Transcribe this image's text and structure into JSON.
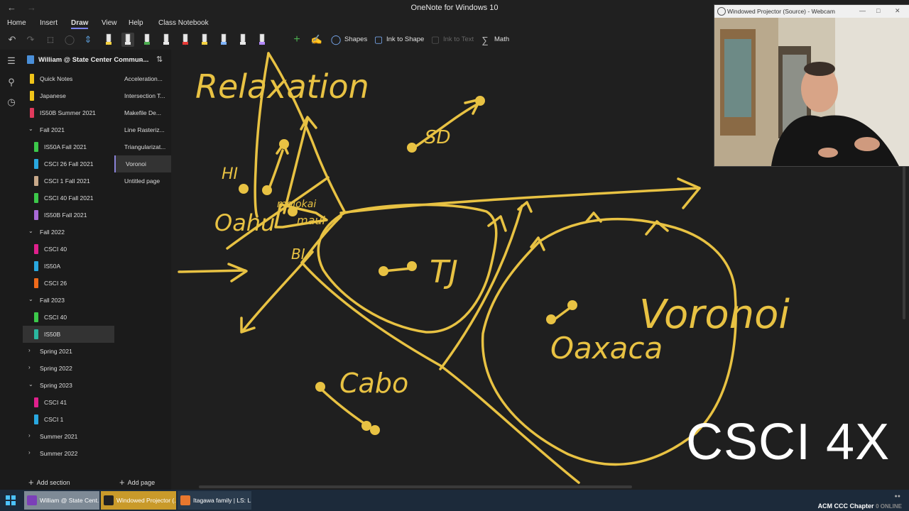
{
  "window": {
    "title": "OneNote for Windows 10"
  },
  "menu": {
    "home": "Home",
    "insert": "Insert",
    "draw": "Draw",
    "view": "View",
    "help": "Help",
    "class_notebook": "Class Notebook"
  },
  "toolbar": {
    "shapes": "Shapes",
    "ink_to_shape": "Ink to Shape",
    "ink_to_text": "Ink to Text",
    "math": "Math"
  },
  "pen_colors": [
    "#f4d03f",
    "#e8e8e8",
    "#4caf50",
    "#e8e8e8",
    "#e53935",
    "#f4d03f",
    "#7fb3ff",
    "#e8e8e8",
    "#b388ff"
  ],
  "notebook": {
    "title": "William @ State Center Commun..."
  },
  "sections": [
    {
      "label": "Quick Notes",
      "color": "#f0c419",
      "level": 0
    },
    {
      "label": "Japanese",
      "color": "#f0c419",
      "level": 0
    },
    {
      "label": "IS50B Summer 2021",
      "color": "#e03a5c",
      "level": 0
    },
    {
      "label": "Fall 2021",
      "group": true,
      "expanded": true
    },
    {
      "label": "IS50A Fall 2021",
      "color": "#3cc84a",
      "level": 1
    },
    {
      "label": "CSCI 26 Fall 2021",
      "color": "#29a8e0",
      "level": 1
    },
    {
      "label": "CSCI 1 Fall 2021",
      "color": "#c8a98a",
      "level": 1
    },
    {
      "label": "CSCI 40 Fall 2021",
      "color": "#3cc84a",
      "level": 1
    },
    {
      "label": "IS50B Fall 2021",
      "color": "#a96ad6",
      "level": 1
    },
    {
      "label": "Fall 2022",
      "group": true,
      "expanded": true
    },
    {
      "label": "CSCI 40",
      "color": "#e0208c",
      "level": 1
    },
    {
      "label": "IS50A",
      "color": "#29a8e0",
      "level": 1
    },
    {
      "label": "CSCI 26",
      "color": "#f06a1a",
      "level": 1
    },
    {
      "label": "Fall 2023",
      "group": true,
      "expanded": true
    },
    {
      "label": "CSCI 40",
      "color": "#3cc84a",
      "level": 1
    },
    {
      "label": "IS50B",
      "color": "#2ab8a0",
      "level": 1,
      "selected": true
    },
    {
      "label": "Spring 2021",
      "group": true,
      "expanded": false
    },
    {
      "label": "Spring 2022",
      "group": true,
      "expanded": false
    },
    {
      "label": "Spring 2023",
      "group": true,
      "expanded": true
    },
    {
      "label": "CSCI 41",
      "color": "#e0208c",
      "level": 1
    },
    {
      "label": "CSCI 1",
      "color": "#29a8e0",
      "level": 1
    },
    {
      "label": "Summer 2021",
      "group": true,
      "expanded": false
    },
    {
      "label": "Summer 2022",
      "group": true,
      "expanded": false
    }
  ],
  "pages": [
    {
      "label": "Acceleration..."
    },
    {
      "label": "Intersection T..."
    },
    {
      "label": "Makefile De..."
    },
    {
      "label": "Line Rasteriz..."
    },
    {
      "label": "Triangularizat..."
    },
    {
      "label": "Voronoi",
      "selected": true
    },
    {
      "label": "Untitled page"
    }
  ],
  "add_section": "Add section",
  "add_page": "Add page",
  "ink": {
    "color": "#e8c243",
    "words": {
      "relaxation": "Relaxation",
      "hi": "HI",
      "oahu": "Oahu",
      "molokai": "molokai",
      "maui": "maui",
      "bi": "BI",
      "sd": "SD",
      "tj": "TJ",
      "oaxaca": "Oaxaca",
      "voronoi": "Voronoi",
      "cabo": "Cabo"
    }
  },
  "webcam": {
    "title": "Windowed Projector (Source) - Webcam"
  },
  "overlay": {
    "text": "CSCI 4X"
  },
  "taskbar": {
    "items": [
      {
        "label": "William @ State Cent...",
        "icon_color": "#7b3fb8"
      },
      {
        "label": "Windowed Projector (...",
        "icon_color": "#222222"
      },
      {
        "label": "Itagawa family | LS: L...",
        "icon_color": "#e8772e"
      }
    ],
    "tray": "ACM CCC Chapter",
    "tray_status": "0 ONLINE"
  }
}
